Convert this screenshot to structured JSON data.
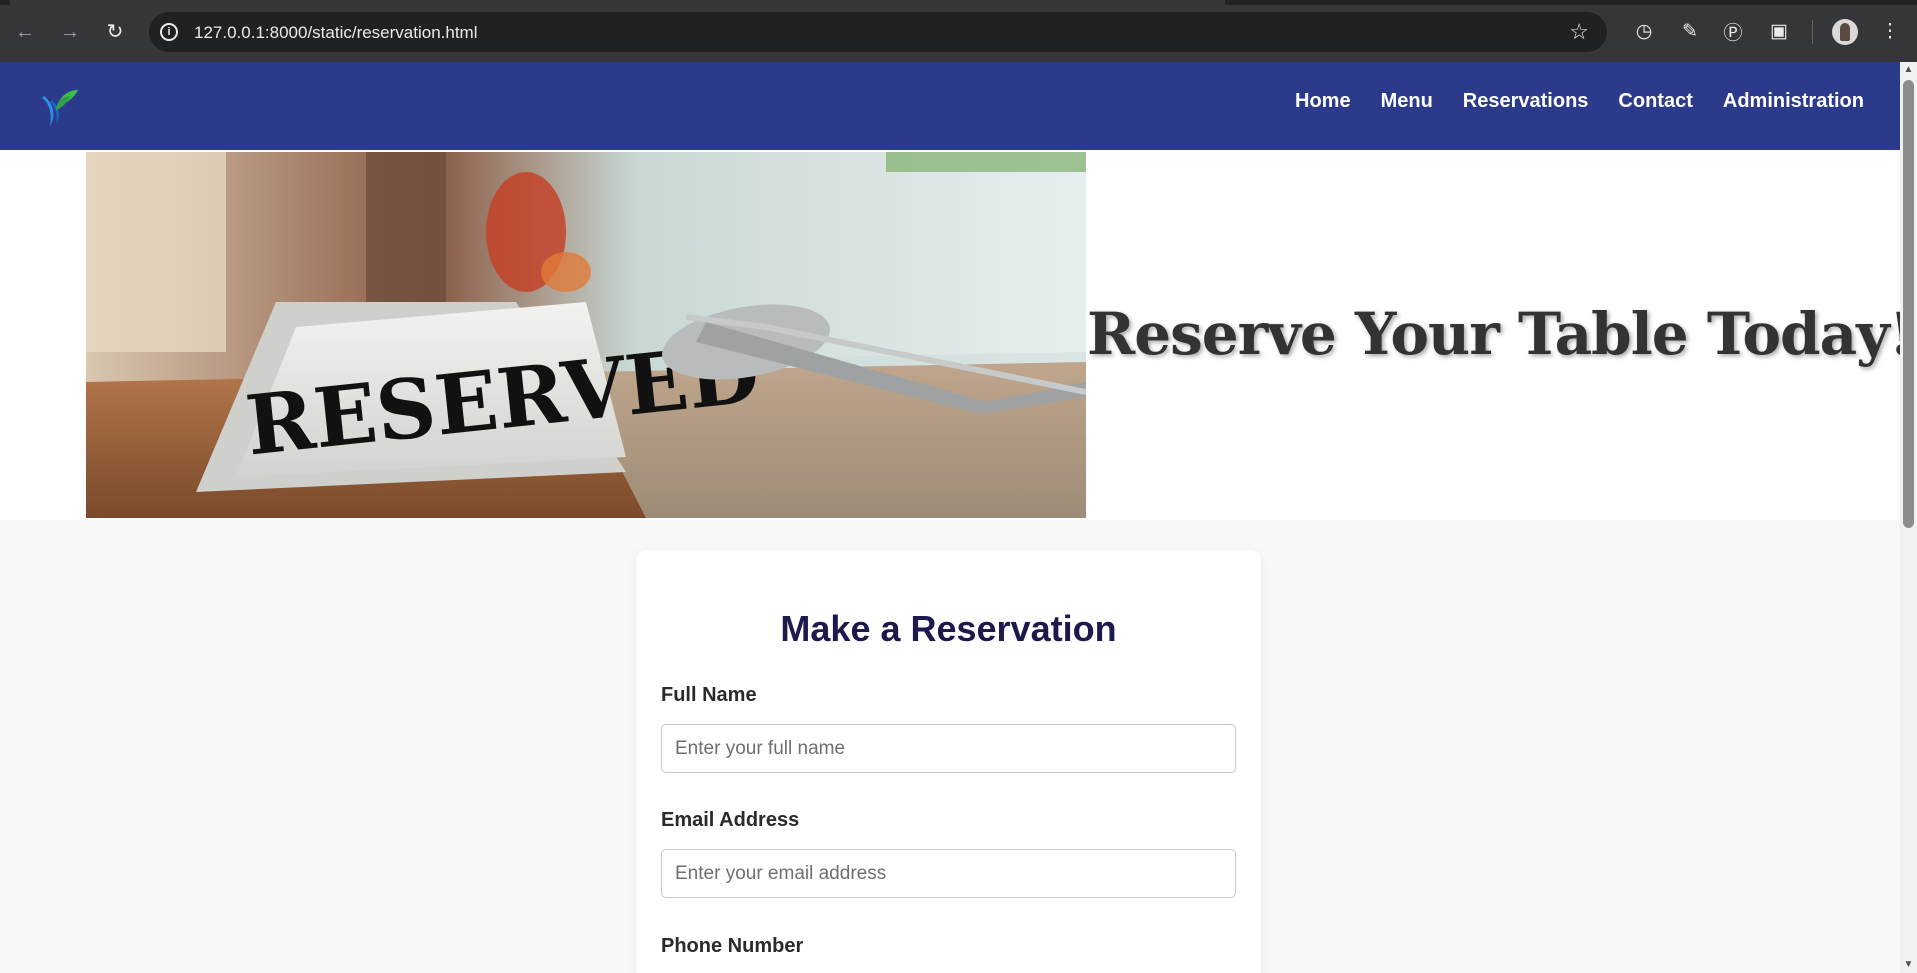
{
  "browser": {
    "url": "127.0.0.1:8000/static/reservation.html"
  },
  "navbar": {
    "links": [
      {
        "label": "Home"
      },
      {
        "label": "Menu"
      },
      {
        "label": "Reservations"
      },
      {
        "label": "Contact"
      },
      {
        "label": "Administration"
      }
    ]
  },
  "hero": {
    "image_sign_text": "RESERVED",
    "title": "Reserve Your Table Today!"
  },
  "form": {
    "title": "Make a Reservation",
    "fields": [
      {
        "label": "Full Name",
        "placeholder": "Enter your full name"
      },
      {
        "label": "Email Address",
        "placeholder": "Enter your email address"
      },
      {
        "label": "Phone Number"
      }
    ]
  },
  "colors": {
    "navbar": "#2c3a8c",
    "form_title": "#1c1a4d"
  }
}
